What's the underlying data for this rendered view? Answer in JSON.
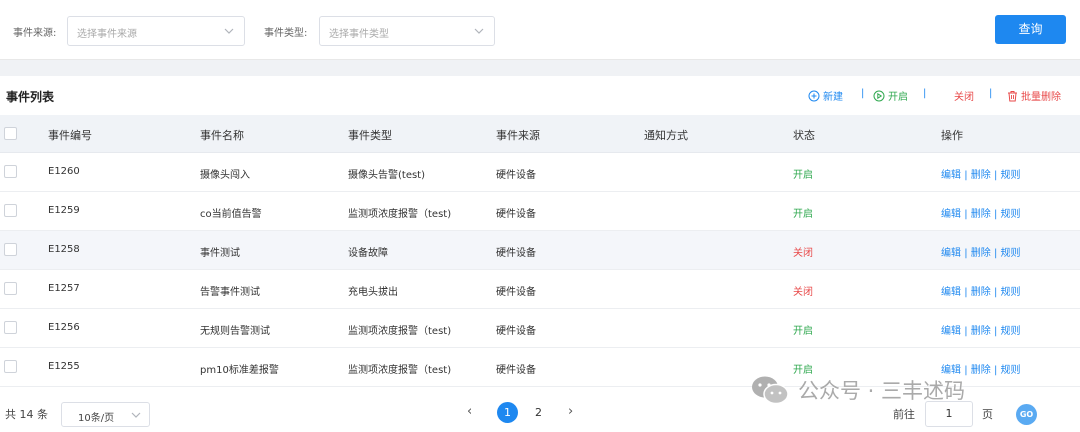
{
  "filters": {
    "source_label": "事件来源:",
    "source_placeholder": "选择事件来源",
    "type_label": "事件类型:",
    "type_placeholder": "选择事件类型",
    "query_label": "查询"
  },
  "panel": {
    "title": "事件列表",
    "toolbar": {
      "new": "新建",
      "enable": "开启",
      "disable": "关闭",
      "batch_delete": "批量删除",
      "sep": "|"
    }
  },
  "columns": [
    "事件编号",
    "事件名称",
    "事件类型",
    "事件来源",
    "通知方式",
    "状态",
    "操作"
  ],
  "rows": [
    {
      "id": "E1260",
      "name": "摄像头闯入",
      "type": "摄像头告警(test)",
      "source": "硬件设备",
      "notify": "",
      "status": "开启"
    },
    {
      "id": "E1259",
      "name": "co当前值告警",
      "type": "监测项浓度报警（test)",
      "source": "硬件设备",
      "notify": "",
      "status": "开启"
    },
    {
      "id": "E1258",
      "name": "事件测试",
      "type": "设备故障",
      "source": "硬件设备",
      "notify": "",
      "status": "关闭"
    },
    {
      "id": "E1257",
      "name": "告警事件测试",
      "type": "充电头拔出",
      "source": "硬件设备",
      "notify": "",
      "status": "关闭"
    },
    {
      "id": "E1256",
      "name": "无规则告警测试",
      "type": "监测项浓度报警（test)",
      "source": "硬件设备",
      "notify": "",
      "status": "开启"
    },
    {
      "id": "E1255",
      "name": "pm10标准差报警",
      "type": "监测项浓度报警（test)",
      "source": "硬件设备",
      "notify": "",
      "status": "开启"
    }
  ],
  "actions": {
    "edit": "编辑",
    "delete": "删除",
    "rules": "规则",
    "sep": "|"
  },
  "pagination": {
    "total": "共 14 条",
    "page_size": "10条/页",
    "pages": [
      "1",
      "2"
    ],
    "current_page": "1",
    "goto_prefix": "前往",
    "goto_value": "1",
    "goto_suffix": "页",
    "go": "GO"
  },
  "watermark": {
    "text": "公众号 · 三丰述码"
  },
  "colors": {
    "primary": "#1e88f0",
    "status_on": "#2fa84f",
    "status_off": "#e84a4a"
  }
}
